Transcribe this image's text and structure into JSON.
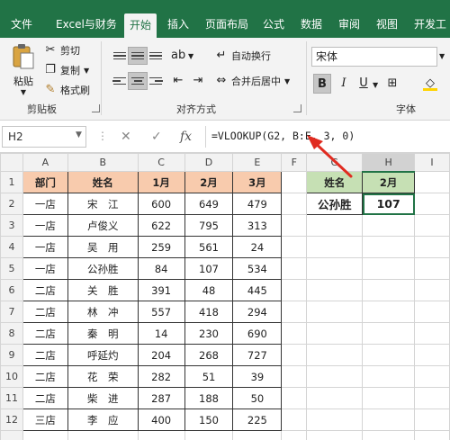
{
  "ribbon": {
    "tabs": [
      "文件",
      "Excel与财务",
      "开始",
      "插入",
      "页面布局",
      "公式",
      "数据",
      "审阅",
      "视图",
      "开发工"
    ],
    "active_tab": "开始",
    "clipboard": {
      "paste": "粘贴",
      "cut": "剪切",
      "copy": "复制",
      "format_painter": "格式刷",
      "group": "剪贴板"
    },
    "alignment": {
      "wrap_text": "自动换行",
      "merge_center": "合并后居中",
      "group": "对齐方式"
    },
    "font": {
      "name": "宋体",
      "group": "字体",
      "bold": "B",
      "italic": "I",
      "underline": "U"
    }
  },
  "formula_bar": {
    "name_box": "H2",
    "fx": "fx",
    "formula": "=VLOOKUP(G2, B:E, 3, 0)"
  },
  "sheet": {
    "columns": [
      "A",
      "B",
      "C",
      "D",
      "E",
      "F",
      "G",
      "H",
      "I"
    ],
    "rows": [
      [
        "部门",
        "姓名",
        "1月",
        "2月",
        "3月",
        "",
        "姓名",
        "2月"
      ],
      [
        "一店",
        "宋　江",
        "600",
        "649",
        "479",
        "",
        "公孙胜",
        "107"
      ],
      [
        "一店",
        "卢俊义",
        "622",
        "795",
        "313",
        "",
        "",
        ""
      ],
      [
        "一店",
        "吴　用",
        "259",
        "561",
        "24",
        "",
        "",
        ""
      ],
      [
        "一店",
        "公孙胜",
        "84",
        "107",
        "534",
        "",
        "",
        ""
      ],
      [
        "二店",
        "关　胜",
        "391",
        "48",
        "445",
        "",
        "",
        ""
      ],
      [
        "二店",
        "林　冲",
        "557",
        "418",
        "294",
        "",
        "",
        ""
      ],
      [
        "二店",
        "秦　明",
        "14",
        "230",
        "690",
        "",
        "",
        ""
      ],
      [
        "二店",
        "呼延灼",
        "204",
        "268",
        "727",
        "",
        "",
        ""
      ],
      [
        "二店",
        "花　荣",
        "282",
        "51",
        "39",
        "",
        "",
        ""
      ],
      [
        "二店",
        "柴　进",
        "287",
        "188",
        "50",
        "",
        "",
        ""
      ],
      [
        "三店",
        "李　应",
        "400",
        "150",
        "225",
        "",
        "",
        ""
      ],
      [
        "",
        "",
        "",
        "",
        "",
        "",
        "",
        ""
      ]
    ],
    "row_numbers": [
      "1",
      "2",
      "3",
      "4",
      "5",
      "6",
      "7",
      "8",
      "9",
      "10",
      "11",
      "12",
      ""
    ]
  },
  "colors": {
    "excel_green": "#217346",
    "header_fill": "#f8cbad",
    "lookup_fill": "#c6e0b4",
    "annotation_arrow": "#e02b20"
  },
  "icons": [
    "paste-icon",
    "cut-icon",
    "copy-icon",
    "format-painter-icon",
    "wrap-text-icon",
    "merge-center-icon",
    "cancel-icon",
    "enter-icon",
    "insert-function-icon",
    "dropdown-icon",
    "annotation-arrow"
  ]
}
